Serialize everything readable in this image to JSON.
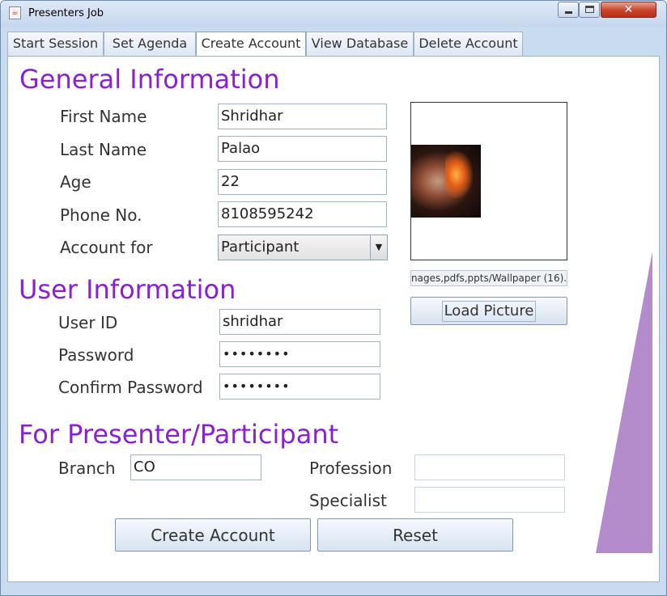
{
  "window": {
    "title": "Presenters Job"
  },
  "tabs": [
    "Start Session",
    "Set Agenda",
    "Create Account",
    "View Database",
    "Delete Account"
  ],
  "active_tab": "Create Account",
  "general": {
    "heading": "General Information",
    "first_name_label": "First Name",
    "first_name_value": "Shridhar",
    "last_name_label": "Last Name",
    "last_name_value": "Palao",
    "age_label": "Age",
    "age_value": "22",
    "phone_label": "Phone No.",
    "phone_value": "8108595242",
    "account_for_label": "Account for",
    "account_for_value": "Participant"
  },
  "picture": {
    "path": "nages,pdfs,ppts/Wallpaper (16).jpg",
    "load_button": "Load Picture"
  },
  "user": {
    "heading": "User Information",
    "user_id_label": "User ID",
    "user_id_value": "shridhar",
    "password_label": "Password",
    "password_value": "••••••••",
    "confirm_label": "Confirm Password",
    "confirm_value": "••••••••"
  },
  "presenter": {
    "heading": "For Presenter/Participant",
    "branch_label": "Branch",
    "branch_value": "CO",
    "profession_label": "Profession",
    "profession_value": "",
    "specialist_label": "Specialist",
    "specialist_value": ""
  },
  "actions": {
    "create": "Create Account",
    "reset": "Reset"
  },
  "colors": {
    "heading": "#8a1fd3",
    "accent_wedge": "#b48ccc",
    "close_button": "#c8432b"
  }
}
